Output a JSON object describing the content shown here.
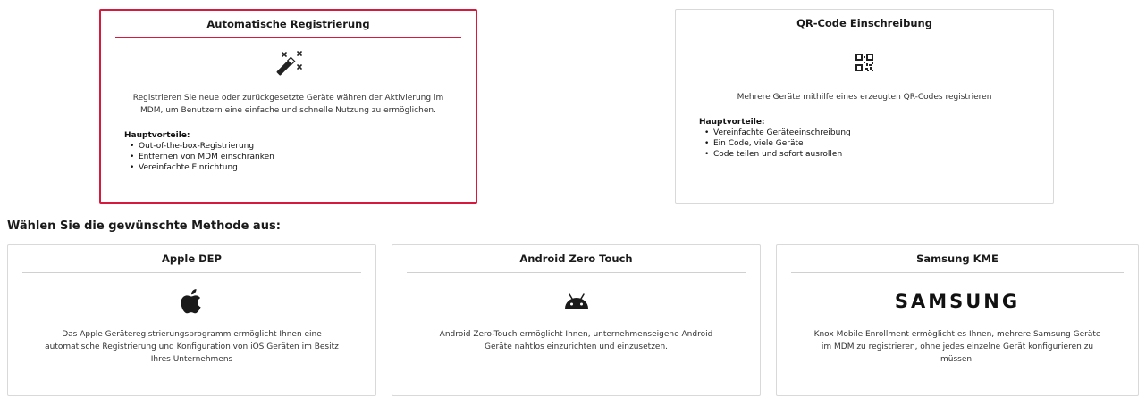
{
  "top_cards": [
    {
      "title": "Automatische Registrierung",
      "icon": "magic-wand-icon",
      "description_lines": [
        "Registrieren Sie neue oder zurückgesetzte Geräte währen der Aktivierung im",
        "MDM, um Benutzern eine einfache und schnelle Nutzung zu ermöglichen."
      ],
      "benefits_heading": "Hauptvorteile:",
      "benefits": [
        "Out-of-the-box-Registrierung",
        "Entfernen von MDM einschränken",
        "Vereinfachte Einrichtung"
      ],
      "selected": true
    },
    {
      "title": "QR-Code Einschreibung",
      "icon": "qr-code-icon",
      "description_lines": [
        "Mehrere Geräte mithilfe eines erzeugten QR-Codes registrieren"
      ],
      "benefits_heading": "Hauptvorteile:",
      "benefits": [
        "Vereinfachte Geräteeinschreibung",
        "Ein Code, viele Geräte",
        "Code teilen und sofort ausrollen"
      ],
      "selected": false
    }
  ],
  "section_heading": "Wählen Sie die gewünschte Methode aus:",
  "method_cards": [
    {
      "title": "Apple DEP",
      "icon": "apple-icon",
      "description_lines": [
        "Das Apple Geräteregistrierungsprogramm ermöglicht Ihnen eine",
        "automatische Registrierung und Konfiguration von iOS Geräten im Besitz",
        "Ihres Unternehmens"
      ]
    },
    {
      "title": "Android Zero Touch",
      "icon": "android-icon",
      "description_lines": [
        "Android Zero-Touch ermöglicht Ihnen, unternehmenseigene Android",
        "Geräte nahtlos einzurichten und einzusetzen."
      ]
    },
    {
      "title": "Samsung KME",
      "icon": "samsung-logo",
      "logo_text": "SAMSUNG",
      "description_lines": [
        "Knox Mobile Enrollment ermöglicht es Ihnen, mehrere Samsung Geräte",
        "im MDM zu registrieren, ohne jedes einzelne Gerät konfigurieren zu",
        "müssen."
      ]
    }
  ],
  "colors": {
    "accent": "#d7193e",
    "border": "#d9d9d9"
  }
}
